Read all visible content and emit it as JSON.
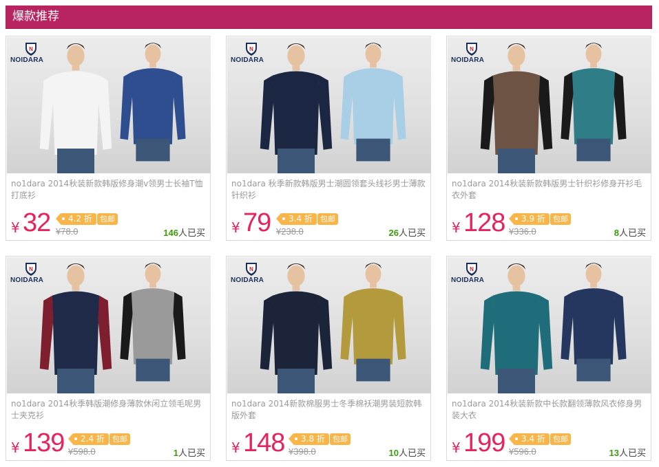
{
  "section": {
    "title": "爆款推荐"
  },
  "brand": {
    "logo_text": "NOIDARA"
  },
  "colors": {
    "header": "#b8245f",
    "price": "#e5235c",
    "tag": "#f7b54a",
    "sold": "#3d9b0c"
  },
  "products": [
    {
      "title": "no1dara 2014秋装新款韩版修身潮v领男士长袖T恤打底衫",
      "price_symbol": "¥",
      "price": "32",
      "discount": "4.2 折",
      "free_shipping": "包邮",
      "original_price": "¥78.0",
      "sold_count": "146",
      "sold_label": "人已买"
    },
    {
      "title": "no1dara 秋季新款韩版男士潮圆领套头线衫男士薄款针织衫",
      "price_symbol": "¥",
      "price": "79",
      "discount": "3.4 折",
      "free_shipping": "包邮",
      "original_price": "¥238.0",
      "sold_count": "26",
      "sold_label": "人已买"
    },
    {
      "title": "no1dara 2014秋装新款韩版男士针织衫修身开衫毛衣外套",
      "price_symbol": "¥",
      "price": "128",
      "discount": "3.9 折",
      "free_shipping": "包邮",
      "original_price": "¥336.0",
      "sold_count": "8",
      "sold_label": "人已买"
    },
    {
      "title": "no1dara 2014秋季韩版潮修身薄款休闲立领毛呢男士夹克衫",
      "price_symbol": "¥",
      "price": "139",
      "discount": "2.4 折",
      "free_shipping": "包邮",
      "original_price": "¥598.0",
      "sold_count": "1",
      "sold_label": "人已买"
    },
    {
      "title": "no1dara 2014新款棉服男士冬季棉袄潮男装短款韩版外套",
      "price_symbol": "¥",
      "price": "148",
      "discount": "3.8 折",
      "free_shipping": "包邮",
      "original_price": "¥398.0",
      "sold_count": "10",
      "sold_label": "人已买"
    },
    {
      "title": "no1dara 2014秋装新款中长款翻领薄款风衣修身男装大衣",
      "price_symbol": "¥",
      "price": "199",
      "discount": "3.4 折",
      "free_shipping": "包邮",
      "original_price": "¥596.0",
      "sold_count": "13",
      "sold_label": "人已买"
    }
  ]
}
